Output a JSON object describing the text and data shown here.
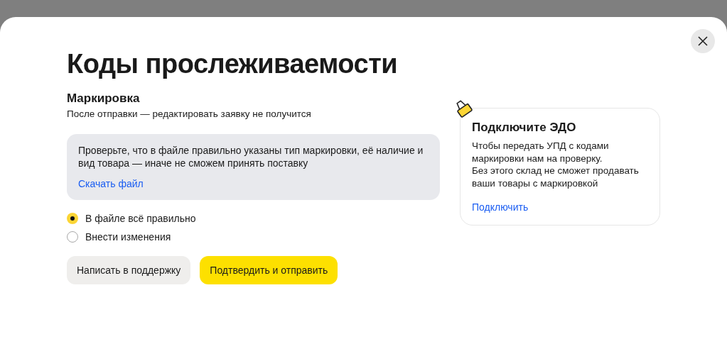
{
  "dialog": {
    "title": "Коды прослеживаемости"
  },
  "section": {
    "title": "Маркировка",
    "subtitle": "После отправки — редактировать заявку не получится"
  },
  "notice": {
    "text": "Проверьте, что в файле правильно указаны тип маркировки, её наличие и вид товара — иначе не сможем принять поставку",
    "link": "Скачать файл"
  },
  "options": [
    {
      "label": "В файле всё правильно",
      "selected": true
    },
    {
      "label": "Внести изменения",
      "selected": false
    }
  ],
  "buttons": [
    {
      "label": "Написать в поддержку",
      "kind": "secondary"
    },
    {
      "label": "Подтвердить и отправить",
      "kind": "primary"
    }
  ],
  "promo": {
    "title": "Подключите ЭДО",
    "lines": [
      "Чтобы передать УПД с кодами маркировки нам на проверку.",
      "Без этого склад не сможет продавать ваши товары с маркировкой"
    ],
    "link": "Подключить"
  }
}
